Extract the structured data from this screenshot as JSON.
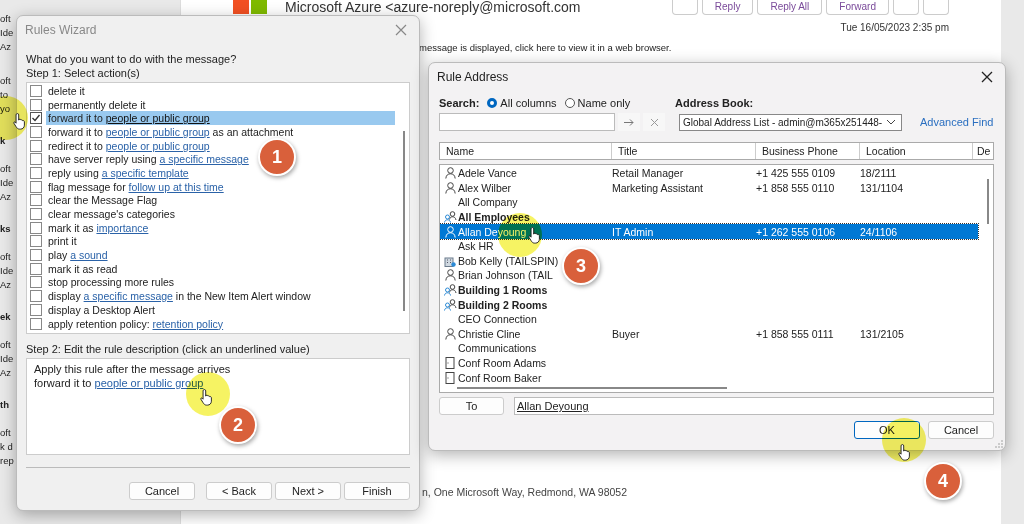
{
  "mail_list": [
    {
      "kind": "mail",
      "lines": [
        "oft",
        "Ide",
        "Az"
      ]
    },
    {
      "kind": "mail",
      "lines": [
        "oft",
        "to",
        "yo"
      ]
    },
    {
      "kind": "group",
      "lines": [
        "k"
      ]
    },
    {
      "kind": "mail",
      "lines": [
        "oft",
        "Ide",
        "Az"
      ]
    },
    {
      "kind": "group",
      "lines": [
        "ks"
      ]
    },
    {
      "kind": "mail",
      "lines": [
        "oft",
        "Ide",
        "Az"
      ]
    },
    {
      "kind": "group",
      "lines": [
        "ek"
      ]
    },
    {
      "kind": "mail",
      "lines": [
        "oft",
        "Ide",
        "Az"
      ]
    },
    {
      "kind": "group",
      "lines": [
        "th"
      ]
    },
    {
      "kind": "mail",
      "lines": [
        "oft",
        "k d",
        "rep"
      ]
    }
  ],
  "message": {
    "sender": "Microsoft Azure <azure-noreply@microsoft.com",
    "toolbar": [
      "Reply",
      "Reply All",
      "Forward"
    ],
    "date": "Tue 16/05/2023 2:35 pm",
    "info": "message is displayed, click here to view it in a web browser.",
    "footer": "n, One Microsoft Way, Redmond, WA 98052"
  },
  "rules_wizard": {
    "title": "Rules Wizard",
    "question": "What do you want to do with the message?",
    "step1": "Step 1: Select action(s)",
    "actions": [
      {
        "checked": false,
        "selected": false,
        "parts": [
          {
            "kind": "text",
            "text": "delete it"
          }
        ]
      },
      {
        "checked": false,
        "selected": false,
        "parts": [
          {
            "kind": "text",
            "text": "permanently delete it"
          }
        ]
      },
      {
        "checked": true,
        "selected": true,
        "parts": [
          {
            "kind": "text",
            "text": "forward it to "
          },
          {
            "kind": "link",
            "text": "people or public group"
          }
        ]
      },
      {
        "checked": false,
        "selected": false,
        "parts": [
          {
            "kind": "text",
            "text": "forward it to "
          },
          {
            "kind": "link",
            "text": "people or public group"
          },
          {
            "kind": "text",
            "text": " as an attachment"
          }
        ]
      },
      {
        "checked": false,
        "selected": false,
        "parts": [
          {
            "kind": "text",
            "text": "redirect it to "
          },
          {
            "kind": "link",
            "text": "people or public group"
          }
        ]
      },
      {
        "checked": false,
        "selected": false,
        "parts": [
          {
            "kind": "text",
            "text": "have server reply using "
          },
          {
            "kind": "link",
            "text": "a specific message"
          }
        ]
      },
      {
        "checked": false,
        "selected": false,
        "parts": [
          {
            "kind": "text",
            "text": "reply using "
          },
          {
            "kind": "link",
            "text": "a specific template"
          }
        ]
      },
      {
        "checked": false,
        "selected": false,
        "parts": [
          {
            "kind": "text",
            "text": "flag message for "
          },
          {
            "kind": "link",
            "text": "follow up at this time"
          }
        ]
      },
      {
        "checked": false,
        "selected": false,
        "parts": [
          {
            "kind": "text",
            "text": "clear the Message Flag"
          }
        ]
      },
      {
        "checked": false,
        "selected": false,
        "parts": [
          {
            "kind": "text",
            "text": "clear message's categories"
          }
        ]
      },
      {
        "checked": false,
        "selected": false,
        "parts": [
          {
            "kind": "text",
            "text": "mark it as "
          },
          {
            "kind": "link",
            "text": "importance"
          }
        ]
      },
      {
        "checked": false,
        "selected": false,
        "parts": [
          {
            "kind": "text",
            "text": "print it"
          }
        ]
      },
      {
        "checked": false,
        "selected": false,
        "parts": [
          {
            "kind": "text",
            "text": "play "
          },
          {
            "kind": "link",
            "text": "a sound"
          }
        ]
      },
      {
        "checked": false,
        "selected": false,
        "parts": [
          {
            "kind": "text",
            "text": "mark it as read"
          }
        ]
      },
      {
        "checked": false,
        "selected": false,
        "parts": [
          {
            "kind": "text",
            "text": "stop processing more rules"
          }
        ]
      },
      {
        "checked": false,
        "selected": false,
        "parts": [
          {
            "kind": "text",
            "text": "display "
          },
          {
            "kind": "link",
            "text": "a specific message"
          },
          {
            "kind": "text",
            "text": " in the New Item Alert window"
          }
        ]
      },
      {
        "checked": false,
        "selected": false,
        "parts": [
          {
            "kind": "text",
            "text": "display a Desktop Alert"
          }
        ]
      },
      {
        "checked": false,
        "selected": false,
        "parts": [
          {
            "kind": "text",
            "text": "apply retention policy: "
          },
          {
            "kind": "link",
            "text": "retention policy"
          }
        ]
      }
    ],
    "step2": "Step 2: Edit the rule description (click an underlined value)",
    "description": [
      [
        {
          "kind": "text",
          "text": "Apply this rule after the message arrives"
        }
      ],
      [
        {
          "kind": "text",
          "text": "forward it to "
        },
        {
          "kind": "link",
          "text": "people or public group"
        }
      ]
    ],
    "buttons": [
      "Cancel",
      "< Back",
      "Next >",
      "Finish"
    ]
  },
  "rule_address": {
    "title": "Rule Address",
    "search_label": "Search:",
    "search_options": [
      {
        "label": "All columns",
        "selected": true
      },
      {
        "label": "Name only",
        "selected": false
      }
    ],
    "address_book_label": "Address Book:",
    "address_book": "Global Address List - admin@m365x251448-",
    "advanced_find": "Advanced Find",
    "columns": [
      "Name",
      "Title",
      "Business Phone",
      "Location",
      "De"
    ],
    "contacts": [
      {
        "kind": "person",
        "name": "Adele Vance",
        "title": "Retail Manager",
        "phone": "+1 425 555 0109",
        "location": "18/2111",
        "selected": false
      },
      {
        "kind": "person",
        "name": "Alex Wilber",
        "title": "Marketing Assistant",
        "phone": "+1 858 555 0110",
        "location": "131/1104",
        "selected": false
      },
      {
        "kind": "none",
        "name": "All Company",
        "selected": false
      },
      {
        "kind": "group",
        "name": "All Employees",
        "selected": false
      },
      {
        "kind": "person",
        "name": "Allan Deyoung",
        "title": "IT Admin",
        "phone": "+1 262 555 0106",
        "location": "24/1106",
        "selected": true
      },
      {
        "kind": "none",
        "name": "Ask HR",
        "selected": false
      },
      {
        "kind": "external",
        "name": "Bob Kelly (TAILSPIN)",
        "selected": false
      },
      {
        "kind": "person",
        "name": "Brian Johnson (TAIL",
        "selected": false
      },
      {
        "kind": "group",
        "name": "Building 1 Rooms",
        "selected": false
      },
      {
        "kind": "group",
        "name": "Building 2 Rooms",
        "selected": false
      },
      {
        "kind": "none",
        "name": "CEO Connection",
        "selected": false
      },
      {
        "kind": "person",
        "name": "Christie Cline",
        "title": "Buyer",
        "phone": "+1 858 555 0111",
        "location": "131/2105",
        "selected": false
      },
      {
        "kind": "none",
        "name": "Communications",
        "selected": false
      },
      {
        "kind": "room",
        "name": "Conf Room Adams",
        "selected": false
      },
      {
        "kind": "room",
        "name": "Conf Room Baker",
        "selected": false
      }
    ],
    "to_button": "To",
    "to_value": "Allan Deyoung",
    "buttons": [
      "OK",
      "Cancel"
    ]
  },
  "annotations": [
    "1",
    "2",
    "3",
    "4"
  ]
}
